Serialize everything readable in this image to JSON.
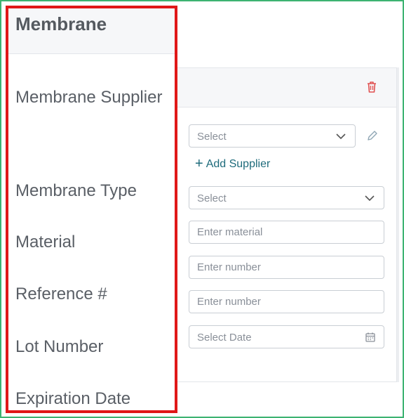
{
  "section": {
    "title": "Membrane"
  },
  "labels": {
    "supplier": "Membrane Supplier",
    "type": "Membrane Type",
    "material": "Material",
    "reference": "Reference #",
    "lot": "Lot Number",
    "expiration": "Expiration Date"
  },
  "fields": {
    "supplier": {
      "value": "Select"
    },
    "add_supplier_label": "Add Supplier",
    "type": {
      "value": "Select"
    },
    "material": {
      "placeholder": "Enter material"
    },
    "reference": {
      "placeholder": "Enter number"
    },
    "lot": {
      "placeholder": "Enter number"
    },
    "expiration": {
      "placeholder": "Select Date"
    }
  },
  "icons": {
    "delete": "trash-icon",
    "edit": "pencil-icon",
    "dropdown": "chevron-down-icon",
    "calendar": "calendar-icon",
    "add": "plus-icon"
  },
  "colors": {
    "accent_link": "#1e6b7b",
    "delete": "#e05252",
    "highlight": "#e01818",
    "frame": "#3cb371"
  }
}
